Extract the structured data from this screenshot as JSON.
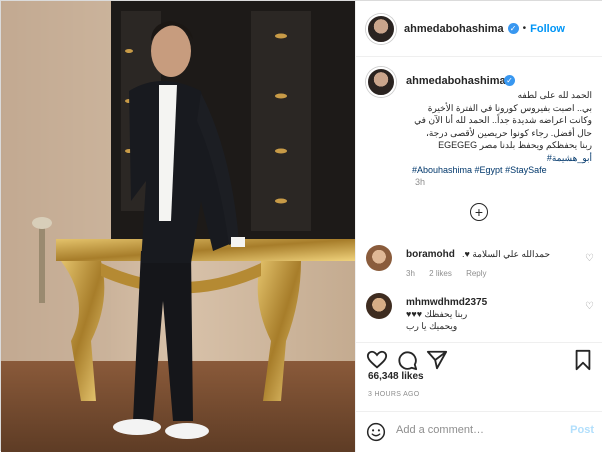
{
  "post": {
    "username": "ahmedabohashima",
    "follow_label": "Follow",
    "separator": "•",
    "caption": {
      "lines": [
        "الحمد لله على لطفه",
        "بي.. اصبت بفيروس كورونا في الفترة الأخيرة",
        "وكانت اعراضه شديدة جداً.. الحمد لله أنا الآن في",
        "حال أفضل. رجاء كونوا حريصين لأقصى درجة،",
        "ربنا يحفظكم ويحفظ بلدنا مصر EGEGEG"
      ],
      "mention": "أبو_هشيمة#",
      "hashtags": "#Abouhashima #Egypt #StaySafe",
      "time": "3h"
    },
    "comments": [
      {
        "username": "boramohd",
        "text": "حمدالله علي السلامة ♥.",
        "time": "3h",
        "likes": "2 likes",
        "reply": "Reply"
      },
      {
        "username": "mhmwdhmd2375",
        "text": "ربنا يحفظك ♥♥♥",
        "text2": "ويحميك يا رب",
        "time": "",
        "likes": "",
        "reply": ""
      }
    ],
    "likes_count": "66,348 likes",
    "posted_ago": "3 HOURS AGO",
    "add_comment_placeholder": "Add a comment…",
    "post_label": "Post"
  },
  "icons": {
    "verified": "verified-badge-icon",
    "add_more": "plus-circle-icon",
    "like": "heart-icon",
    "comment": "comment-icon",
    "share": "paper-plane-icon",
    "save": "bookmark-icon",
    "emoji": "smile-icon",
    "comment_like": "heart-outline-icon"
  },
  "colors": {
    "accent": "#0095f6",
    "link": "#00376b",
    "muted": "#8e8e8e",
    "post_disabled": "#b2dffc"
  }
}
